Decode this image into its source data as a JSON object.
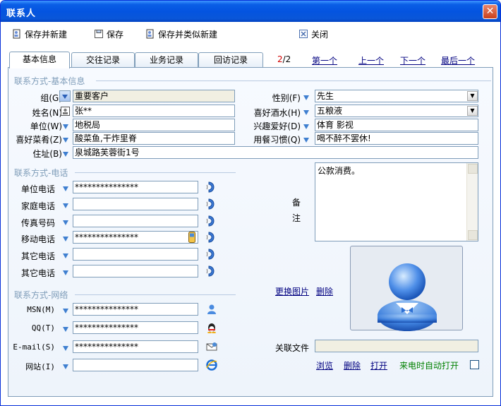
{
  "window": {
    "title": "联系人",
    "close_label": "✕"
  },
  "toolbar": {
    "save_new": "保存并新建",
    "save": "保存",
    "save_similar": "保存并类似新建",
    "close": "关闭"
  },
  "tabs": [
    "基本信息",
    "交往记录",
    "业务记录",
    "回访记录"
  ],
  "pager": {
    "current": "2",
    "total": "/2",
    "first": "第一个",
    "prev": "上一个",
    "next": "下一个",
    "last": "最后一个"
  },
  "sections": {
    "basic": "联系方式-基本信息",
    "phone": "联系方式-电话",
    "network": "联系方式-网络"
  },
  "basic": {
    "group_label": "组(G)",
    "group_value": "重要客户",
    "name_label": "姓名(N)",
    "name_value": "张**",
    "company_label": "单位(W)",
    "company_value": "地税局",
    "dish_label": "喜好菜肴(Z)",
    "dish_value": "酸菜鱼,干炸里脊",
    "address_label": "住址(B)",
    "address_value": "泉城路芙蓉街1号",
    "gender_label": "性别(F)",
    "gender_value": "先生",
    "drink_label": "喜好酒水(H)",
    "drink_value": "五粮液",
    "hobby_label": "兴趣爱好(D)",
    "hobby_value": "体育 影视",
    "dining_label": "用餐习惯(Q)",
    "dining_value": "喝不醉不罢休!"
  },
  "phones": [
    {
      "label": "单位电话",
      "value": "***************"
    },
    {
      "label": "家庭电话",
      "value": ""
    },
    {
      "label": "传真号码",
      "value": ""
    },
    {
      "label": "移动电话",
      "value": "***************"
    },
    {
      "label": "其它电话",
      "value": ""
    },
    {
      "label": "其它电话",
      "value": ""
    }
  ],
  "network": [
    {
      "label": "MSN(M)",
      "value": "***************",
      "icon": "msn-icon"
    },
    {
      "label": "QQ(T)",
      "value": "***************",
      "icon": "qq-icon"
    },
    {
      "label": "E-mail(S)",
      "value": "***************",
      "icon": "email-icon"
    },
    {
      "label": "网站(I)",
      "value": "",
      "icon": "ie-icon"
    }
  ],
  "remarks": {
    "label_1": "备",
    "label_2": "注",
    "value": "公款消费。"
  },
  "photo": {
    "change": "更换图片",
    "delete": "删除"
  },
  "files": {
    "label": "关联文件",
    "browse": "浏览",
    "delete": "删除",
    "open": "打开",
    "auto_open": "来电时自动打开"
  }
}
